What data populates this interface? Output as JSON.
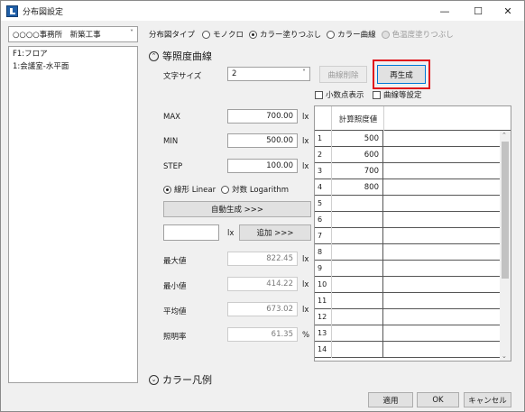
{
  "window": {
    "title": "分布図設定",
    "minimize": "—",
    "maximize": "☐",
    "close": "✕"
  },
  "left": {
    "select_value": "○○○○事務所　新築工事",
    "items": [
      "F1:フロア",
      "1:会議室-水平面"
    ]
  },
  "type_row": {
    "label": "分布図タイプ",
    "options": [
      {
        "label": "モノクロ",
        "selected": false,
        "disabled": false
      },
      {
        "label": "カラー塗りつぶし",
        "selected": true,
        "disabled": false
      },
      {
        "label": "カラー曲線",
        "selected": false,
        "disabled": false
      },
      {
        "label": "色温度塗りつぶし",
        "selected": false,
        "disabled": true
      }
    ]
  },
  "contour": {
    "section_title": "等照度曲線",
    "font_size_label": "文字サイズ",
    "font_size_value": "2",
    "delete_curve_button": "曲線削除",
    "regenerate_button": "再生成",
    "decimal_checkbox": "小数点表示",
    "curve_settings_checkbox": "曲線等設定",
    "max_label": "MAX",
    "max_value": "700.00",
    "min_label": "MIN",
    "min_value": "500.00",
    "step_label": "STEP",
    "step_value": "100.00",
    "unit_lx": "lx",
    "unit_pct": "%",
    "scale_linear": "線形 Linear",
    "scale_log": "対数 Logarithm",
    "auto_generate_button": "自動生成 >>>",
    "add_input_value": "",
    "add_button": "追加 >>>",
    "max_stat_label": "最大値",
    "max_stat_value": "822.45",
    "min_stat_label": "最小値",
    "min_stat_value": "414.22",
    "avg_stat_label": "平均値",
    "avg_stat_value": "673.02",
    "ratio_stat_label": "照明率",
    "ratio_stat_value": "61.35"
  },
  "grid": {
    "header": "計算照度値",
    "rows": [
      {
        "n": "1",
        "v": "500"
      },
      {
        "n": "2",
        "v": "600"
      },
      {
        "n": "3",
        "v": "700"
      },
      {
        "n": "4",
        "v": "800"
      },
      {
        "n": "5",
        "v": ""
      },
      {
        "n": "6",
        "v": ""
      },
      {
        "n": "7",
        "v": ""
      },
      {
        "n": "8",
        "v": ""
      },
      {
        "n": "9",
        "v": ""
      },
      {
        "n": "10",
        "v": ""
      },
      {
        "n": "11",
        "v": ""
      },
      {
        "n": "12",
        "v": ""
      },
      {
        "n": "13",
        "v": ""
      },
      {
        "n": "14",
        "v": ""
      }
    ]
  },
  "legend_section_title": "カラー凡例",
  "footer": {
    "apply": "適用",
    "ok": "OK",
    "cancel": "キャンセル"
  },
  "colors": {
    "highlight": "#e0141b",
    "accent": "#0078d7"
  }
}
